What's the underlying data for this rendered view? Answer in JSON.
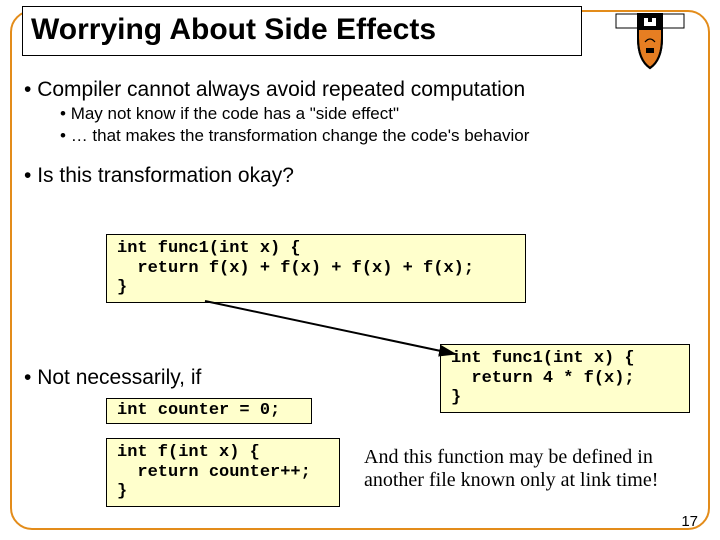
{
  "title": "Worrying About Side Effects",
  "bullets": {
    "b1": "Compiler cannot always avoid repeated computation",
    "b1a": "May not know if the code has a \"side effect\"",
    "b1b": "… that makes the transformation change the code's behavior",
    "b2": "Is this transformation okay?",
    "b3": "Not necessarily, if"
  },
  "code": {
    "func1a": "int func1(int x) {\n  return f(x) + f(x) + f(x) + f(x);\n}",
    "func1b": "int func1(int x) {\n  return 4 * f(x);\n}",
    "counter": "int counter = 0;",
    "fdef": "int f(int x) {\n  return counter++;\n}"
  },
  "note": "And this function may be defined in another file known only at link time!",
  "page_number": "17",
  "logo_name": "princeton-shield"
}
